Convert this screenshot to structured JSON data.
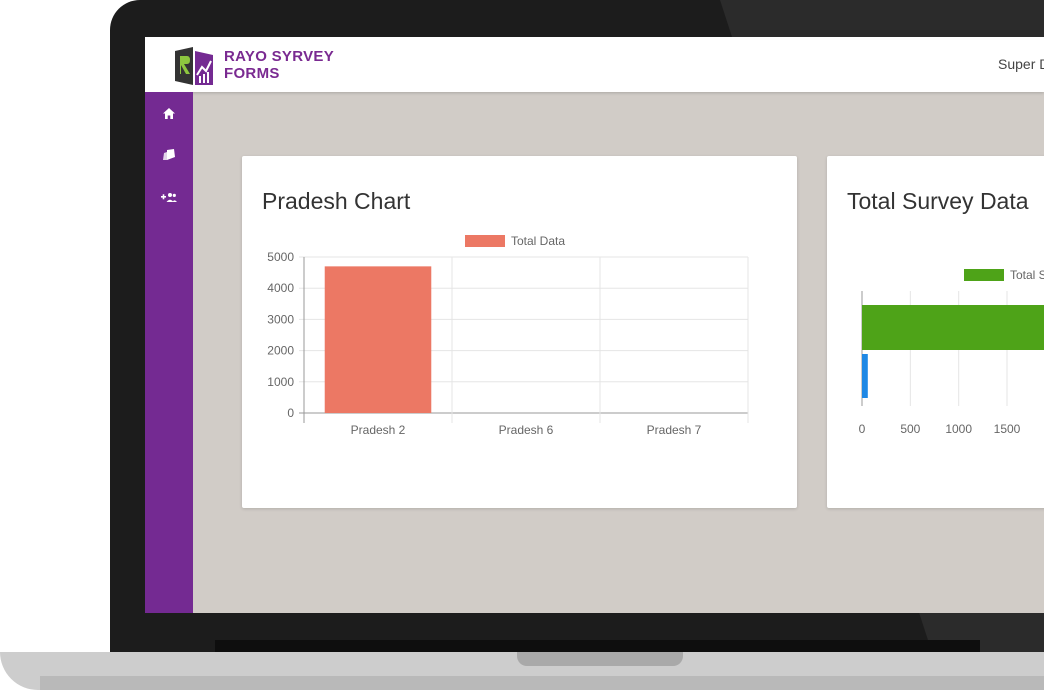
{
  "app": {
    "brand_line1": "RAYO SYRVEY",
    "brand_line2": "FORMS",
    "user_label": "Super D",
    "brand_color": "#742a92"
  },
  "sidebar": {
    "items": [
      {
        "icon": "home-icon"
      },
      {
        "icon": "forms-icon"
      },
      {
        "icon": "add-users-icon"
      }
    ]
  },
  "cards": [
    {
      "title": "Pradesh Chart"
    },
    {
      "title": "Total Survey Data"
    }
  ],
  "chart_data": [
    {
      "type": "bar",
      "title": "",
      "legend": [
        "Total Data"
      ],
      "categories": [
        "Pradesh 2",
        "Pradesh 6",
        "Pradesh 7"
      ],
      "series": [
        {
          "name": "Total Data",
          "values": [
            4700,
            0,
            0
          ],
          "color": "#ec7864"
        }
      ],
      "yticks": [
        "0",
        "1000",
        "2000",
        "3000",
        "4000",
        "5000"
      ],
      "ylim": [
        0,
        5000
      ],
      "grid": true,
      "legend_position": "top"
    },
    {
      "type": "bar",
      "orientation": "horizontal",
      "title": "",
      "legend": [
        "Total S"
      ],
      "xticks": [
        "0",
        "500",
        "1000",
        "1500"
      ],
      "values": [
        4700,
        60
      ],
      "colors": [
        "#4ea318",
        "#1e88e5"
      ],
      "grid": true,
      "legend_position": "top"
    }
  ]
}
